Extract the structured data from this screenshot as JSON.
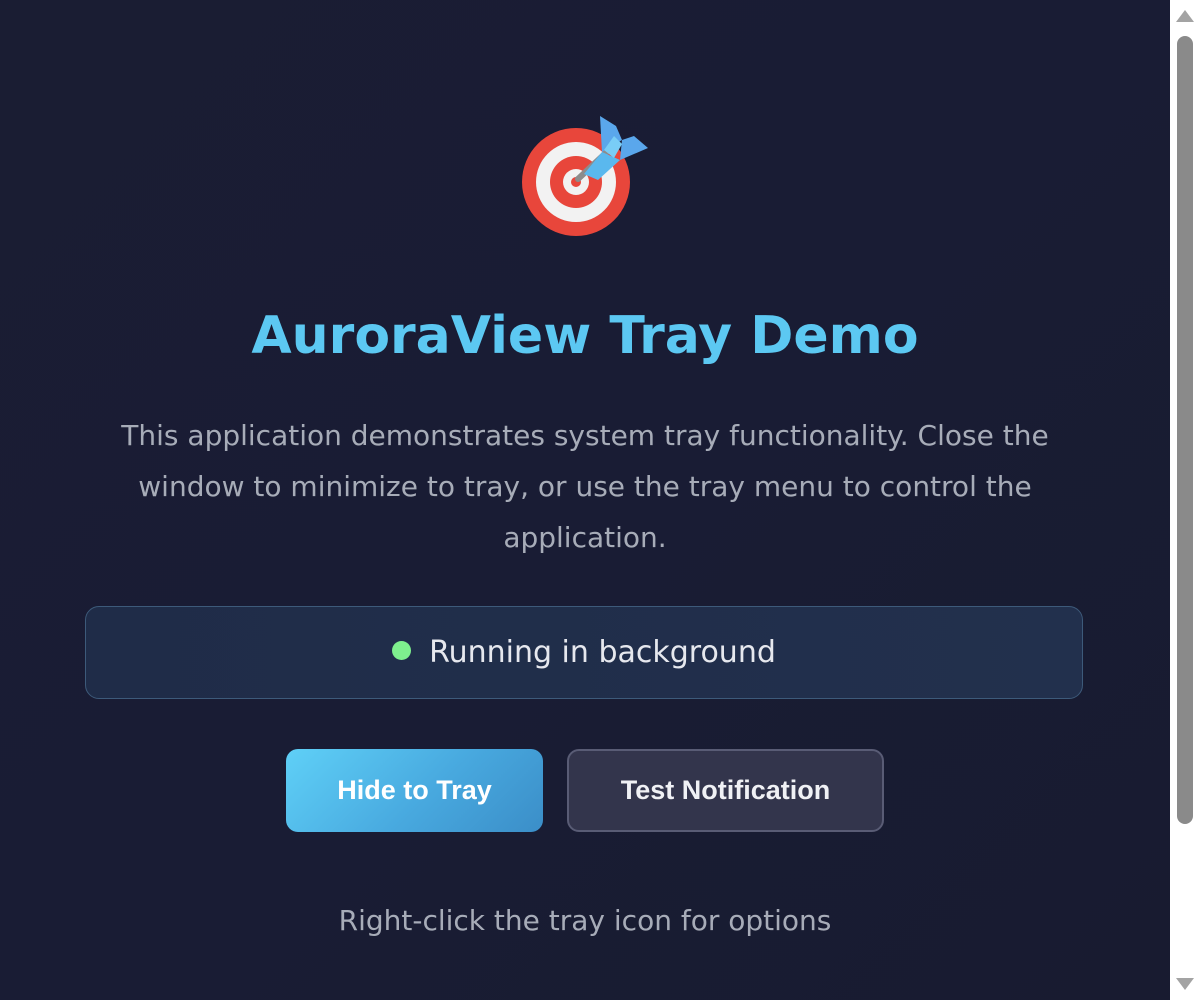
{
  "app": {
    "icon": "direct-hit-target-icon",
    "title": "AuroraView Tray Demo",
    "description": "This application demonstrates system tray functionality. Close the window to minimize to tray, or use the tray menu to control the application."
  },
  "status": {
    "text": "Running in background",
    "indicator_color": "#7ef08e"
  },
  "actions": {
    "hide_label": "Hide to Tray",
    "notify_label": "Test Notification"
  },
  "hint": "Right-click the tray icon for options",
  "colors": {
    "accent": "#5cc8f2",
    "background": "#1a1d33"
  }
}
